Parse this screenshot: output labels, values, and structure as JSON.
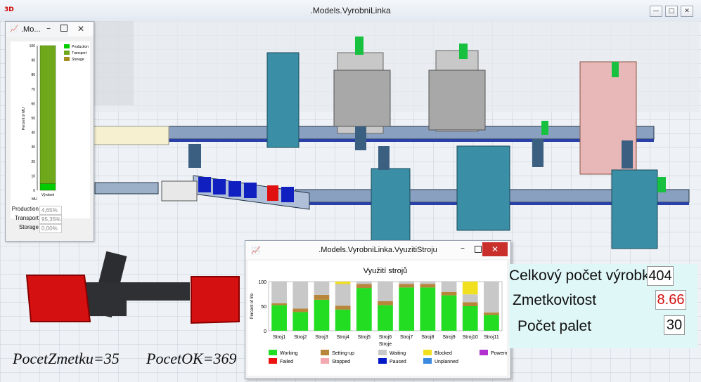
{
  "window": {
    "title": ".Models.VyrobniLinka",
    "app_icon": "3D"
  },
  "stats_panel": {
    "title": ".Mo...",
    "chart_ylabel": "Percent of MU",
    "chart_xlabel": "MU",
    "category_label": "Výrobek",
    "legend": [
      {
        "name": "Production",
        "color": "#00cc00"
      },
      {
        "name": "Transport",
        "color": "#6fa81a"
      },
      {
        "name": "Storage",
        "color": "#a89020"
      }
    ],
    "rows": [
      {
        "label": "Production",
        "value": "4,65%"
      },
      {
        "label": "Transport",
        "value": "95,35%"
      },
      {
        "label": "Storage",
        "value": "0,00%"
      }
    ]
  },
  "util_window": {
    "title": ".Models.VyrobniLinka.VyuzitiStroju"
  },
  "info": {
    "total_label": "Celkový počet výrobků",
    "total_value": "404",
    "scrap_label": "Zmetkovitost",
    "scrap_value": "8.66",
    "pallets_label": "Počet palet",
    "pallets_value": "30"
  },
  "counters": {
    "scrap": "PocetZmetku=35",
    "ok": "PocetOK=369"
  },
  "chart_data": [
    {
      "type": "bar",
      "stacked": true,
      "title": "",
      "categories": [
        "Výrobek"
      ],
      "ylabel": "Percent of MU",
      "xlabel": "MU",
      "ylim": [
        0,
        100
      ],
      "yticks": [
        0,
        10,
        20,
        30,
        40,
        50,
        60,
        70,
        80,
        90,
        100
      ],
      "series": [
        {
          "name": "Production",
          "color": "#00cc00",
          "values": [
            4.65
          ]
        },
        {
          "name": "Transport",
          "color": "#6fa81a",
          "values": [
            95.35
          ]
        },
        {
          "name": "Storage",
          "color": "#a89020",
          "values": [
            0
          ]
        }
      ]
    },
    {
      "type": "bar",
      "stacked": true,
      "title": "Využití strojů",
      "ylabel": "Percent of life",
      "ylim": [
        0,
        100
      ],
      "yticks": [
        0,
        50,
        100
      ],
      "categories": [
        "Stroj1",
        "Stroj2",
        "Stroj3",
        "Stroj4",
        "Stroj5",
        "Stroj6",
        "Stroj7",
        "Stroj8",
        "Stroj9",
        "Stroj10",
        "Stroj11"
      ],
      "extra_xlabel": "Stroje",
      "series": [
        {
          "name": "Working",
          "color": "#22dd22",
          "values": [
            52,
            38,
            63,
            43,
            87,
            52,
            88,
            88,
            72,
            50,
            32
          ]
        },
        {
          "name": "Setting-up",
          "color": "#b8863a",
          "values": [
            4,
            7,
            10,
            8,
            8,
            8,
            7,
            7,
            7,
            8,
            5
          ]
        },
        {
          "name": "Waiting",
          "color": "#c8c8c8",
          "values": [
            44,
            55,
            27,
            44,
            5,
            40,
            5,
            5,
            21,
            16,
            63
          ]
        },
        {
          "name": "Blocked",
          "color": "#f0e020",
          "values": [
            0,
            0,
            0,
            5,
            0,
            0,
            0,
            0,
            0,
            26,
            0
          ]
        },
        {
          "name": "PoweringUpDown",
          "color": "#b030d0",
          "values": [
            0,
            0,
            0,
            0,
            0,
            0,
            0,
            0,
            0,
            0,
            0
          ]
        },
        {
          "name": "Failed",
          "color": "#ee1111",
          "values": [
            0,
            0,
            0,
            0,
            0,
            0,
            0,
            0,
            0,
            0,
            0
          ]
        },
        {
          "name": "Stopped",
          "color": "#f4a8b0",
          "values": [
            0,
            0,
            0,
            0,
            0,
            0,
            0,
            0,
            0,
            0,
            0
          ]
        },
        {
          "name": "Paused",
          "color": "#0018c8",
          "values": [
            0,
            0,
            0,
            0,
            0,
            0,
            0,
            0,
            0,
            0,
            0
          ]
        },
        {
          "name": "Unplanned",
          "color": "#3a8ae0",
          "values": [
            0,
            0,
            0,
            0,
            0,
            0,
            0,
            0,
            0,
            0,
            0
          ]
        }
      ]
    }
  ]
}
